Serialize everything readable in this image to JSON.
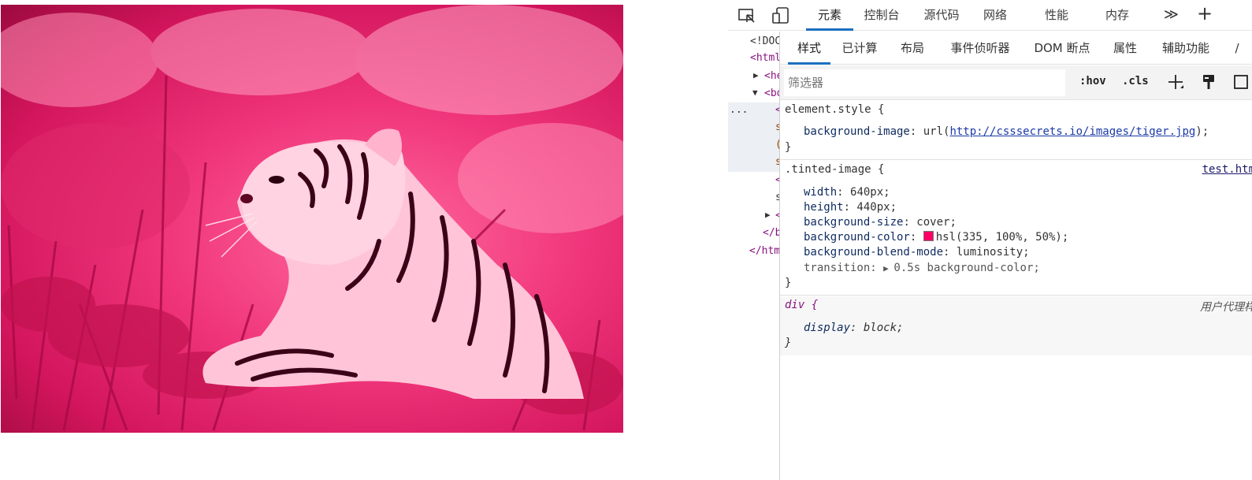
{
  "preview": {
    "image_description_name": "tiger-image",
    "tint_color": "#ff0066"
  },
  "devtools": {
    "tabs": [
      "元素",
      "控制台",
      "源代码",
      "网络",
      "性能",
      "内存"
    ],
    "active_tab": "元素",
    "more_tabs_glyph": "≫",
    "add_tab_glyph": "+",
    "dom_tree": {
      "lines": [
        "<!DOC",
        "<html",
        "<he",
        "<bo",
        "<",
        "s",
        "(",
        "s",
        "<",
        "s",
        "<",
        "</b",
        "</htm"
      ],
      "ellipsis": "..."
    },
    "styles_tabs": [
      "样式",
      "已计算",
      "布局",
      "事件侦听器",
      "DOM 断点",
      "属性",
      "辅助功能",
      "/"
    ],
    "active_styles_tab": "样式",
    "filter": {
      "placeholder": "筛选器",
      "hov": ":hov",
      "cls": ".cls"
    },
    "rules": [
      {
        "selector": "element.style {",
        "close": "}",
        "prop_name": "background-image",
        "prop_prefix": ": url(",
        "url": "http://csssecrets.io/images/tiger.jpg",
        "prop_suffix": ");"
      },
      {
        "selector": ".tinted-image {",
        "source": "test.htm",
        "close": "}",
        "props": [
          {
            "name": "width",
            "value": ": 640px;"
          },
          {
            "name": "height",
            "value": ": 440px;"
          },
          {
            "name": "background-size",
            "value": ": cover;"
          },
          {
            "name": "background-color",
            "value": "hsl(335, 100%, 50%);"
          },
          {
            "name": "background-blend-mode",
            "value": ": luminosity;"
          },
          {
            "name": "transition",
            "value": "0.5s background-color;"
          }
        ],
        "swatch_color": "#ff0066"
      },
      {
        "selector": "div {",
        "source": "用户代理样",
        "close": "}",
        "prop_name": "display",
        "prop_value": ": block;"
      }
    ]
  }
}
